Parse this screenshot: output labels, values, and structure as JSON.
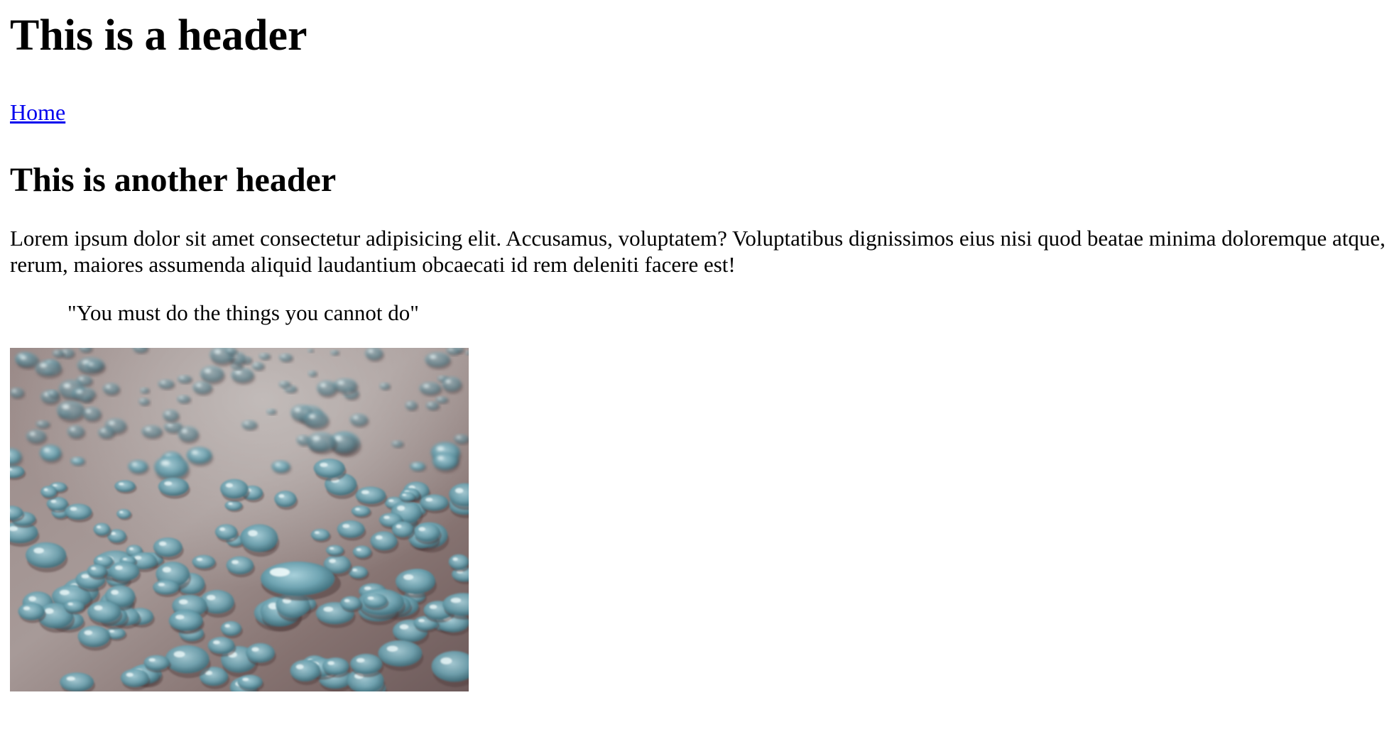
{
  "page": {
    "header": "This is a header",
    "nav": {
      "home_label": "Home"
    },
    "subheader": "This is another header",
    "paragraph": "Lorem ipsum dolor sit amet consectetur adipisicing elit. Accusamus, voluptatem? Voluptatibus dignissimos eius nisi quod beatae minima doloremque atque, rerum, maiores assumenda aliquid laudantium obcaecati id rem deleniti facere est!",
    "quote": "\"You must do the things you cannot do\"",
    "image": {
      "subject": "water droplets on a surface",
      "colors": {
        "background": "#8c7a78",
        "droplet": "#7fb0bd",
        "highlight": "#dcefee"
      }
    }
  }
}
